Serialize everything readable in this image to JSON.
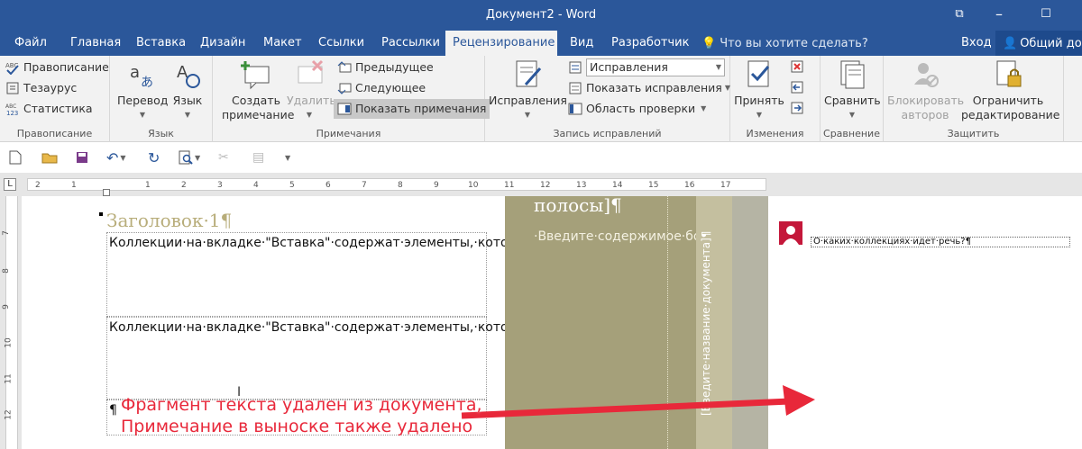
{
  "window": {
    "title": "Документ2 - Word",
    "restore_glyph": "⧉",
    "maximize_glyph": "☐"
  },
  "tabs": [
    {
      "label": "Файл"
    },
    {
      "label": "Главная"
    },
    {
      "label": "Вставка"
    },
    {
      "label": "Дизайн"
    },
    {
      "label": "Макет"
    },
    {
      "label": "Ссылки"
    },
    {
      "label": "Рассылки"
    },
    {
      "label": "Рецензирование",
      "active": true
    },
    {
      "label": "Вид"
    },
    {
      "label": "Разработчик"
    }
  ],
  "tellme": "Что вы хотите сделать?",
  "signin": "Вход",
  "share": "Общий доступ",
  "ribbon": {
    "proofing": {
      "label": "Правописание",
      "spelling": "Правописание",
      "thesaurus": "Тезаурус",
      "stats": "Статистика"
    },
    "language": {
      "label": "Язык",
      "translate": "Перевод",
      "language": "Язык"
    },
    "comments": {
      "label": "Примечания",
      "new_line1": "Создать",
      "new_line2": "примечание",
      "delete": "Удалить",
      "previous": "Предыдущее",
      "next": "Следующее",
      "show": "Показать примечания"
    },
    "tracking": {
      "label": "Запись исправлений",
      "track": "Исправления",
      "display_mode": "Исправления",
      "show_markup": "Показать исправления",
      "review_pane": "Область проверки"
    },
    "changes": {
      "label": "Изменения",
      "accept": "Принять"
    },
    "compare": {
      "label": "Сравнение",
      "compare": "Сравнить"
    },
    "protect": {
      "label": "Защитить",
      "block_line1": "Блокировать",
      "block_line2": "авторов",
      "restrict_line1": "Ограничить",
      "restrict_line2": "редактирование"
    }
  },
  "ruler": {
    "ticks": [
      "2",
      "1",
      "1",
      "2",
      "3",
      "4",
      "5",
      "6",
      "7",
      "8",
      "9",
      "10",
      "11",
      "12",
      "13",
      "14",
      "15",
      "16",
      "17"
    ],
    "corner": "L"
  },
  "vruler": {
    "ticks": [
      "7",
      "8",
      "9",
      "10",
      "11",
      "12"
    ]
  },
  "document": {
    "heading": "Заголовок·1¶",
    "para1": "Коллекции·на·вкладке·\"Вставка\"·содержат·элементы,·которые·определяют·общий·вид·документа.·Эти·коллекции·служат·для·вставки·в·документ·таблиц,·колонтитулов,·списков,·титульных·страниц·и·других·стандартных·блоков.¶",
    "para2": "Коллекции·на·вкладке·\"Вставка\"·содержат·элементы,·которые·определяют·общий·вид·документа.·Эти·коллекции·служат·для·вставки·в·документ·таблиц,·колонтитулов,·списков,·титульных·страниц·и·других·стандартных·блоков.¶",
    "para3": "¶",
    "sidebar_title": "полосы]¶",
    "sidebar_body": "·Введите·содержимое·боковой·полосы.·Боковая·полоса·представляет·собой·независимое·дополнение·к·основному·",
    "vertical_text": "[Введите·название·документа]¶",
    "comment": "О·каких·коллекциях·идет·речь?¶"
  },
  "annotation": {
    "line1": "Фрагмент текста удален из документа,",
    "line2": "Примечание в выноске также удалено"
  },
  "colors": {
    "accent": "#2b579a",
    "sidebar": "#a5a07a",
    "arrow": "#e8283a"
  }
}
